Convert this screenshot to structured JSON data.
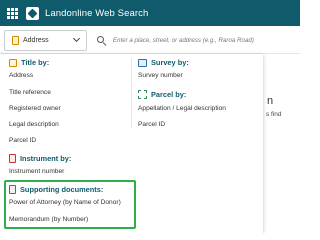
{
  "header": {
    "app_title": "Landonline Web Search"
  },
  "search": {
    "type_label": "Address",
    "placeholder": "Enter a place, street, or address (e.g., Raroa Road)"
  },
  "background": {
    "letter": "n",
    "fragment": "s find"
  },
  "dropdown": {
    "title_by": {
      "heading": "Title by:",
      "items": [
        "Address",
        "Title reference",
        "Registered owner",
        "Legal description",
        "Parcel ID"
      ]
    },
    "survey_by": {
      "heading": "Survey by:",
      "items": [
        "Survey number"
      ]
    },
    "parcel_by": {
      "heading": "Parcel by:",
      "items": [
        "Appellation / Legal description",
        "Parcel ID"
      ]
    },
    "instrument_by": {
      "heading": "Instrument by:",
      "items": [
        "Instrument number"
      ]
    },
    "supporting_documents": {
      "heading": "Supporting documents:",
      "items": [
        "Power of Attorney (by Name of Donor)",
        "Memorandum (by Number)"
      ]
    }
  },
  "colors": {
    "header_bg": "#0f5b6b",
    "heading_text": "#0f5b6b",
    "highlight_border": "#2fae4a"
  },
  "icons": {
    "menu": "apps-grid-icon",
    "logo": "landonline-logo-icon",
    "type": "book-icon",
    "search": "search-icon",
    "title_by": "book-icon",
    "survey_by": "map-icon",
    "parcel_by": "parcel-icon",
    "instrument_by": "document-red-icon",
    "supporting_documents": "document-icon"
  }
}
